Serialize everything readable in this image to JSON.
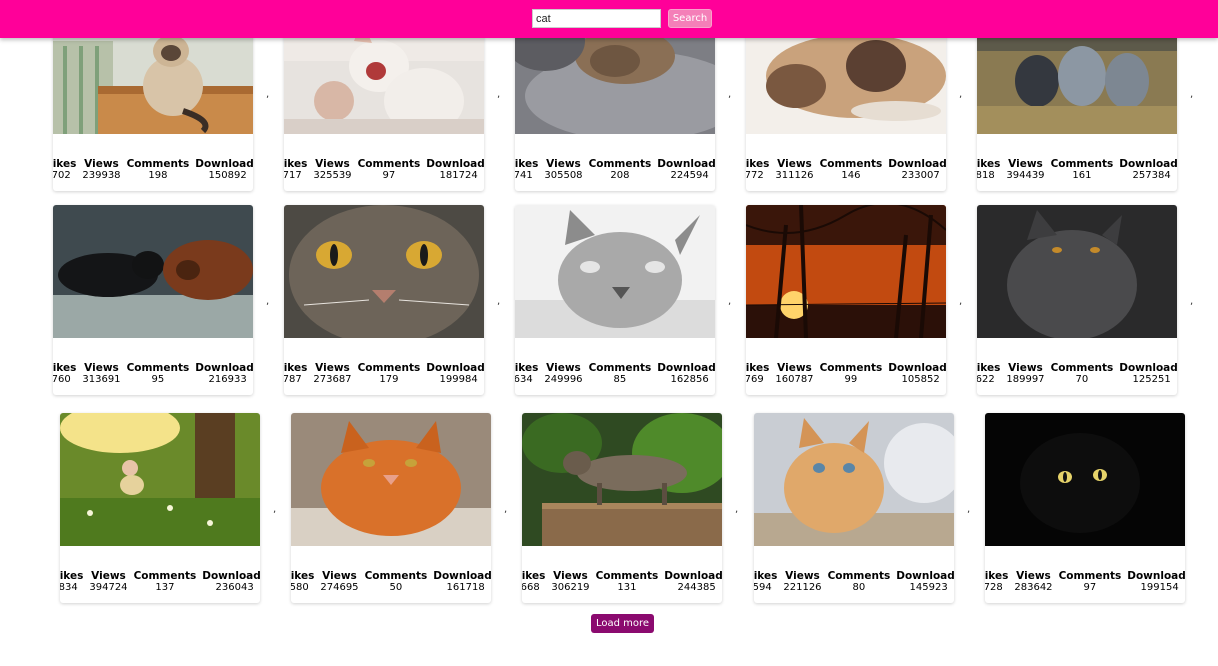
{
  "search": {
    "value": "cat",
    "button_label": "Search"
  },
  "stat_labels": {
    "likes": "Likes",
    "views": "Views",
    "comments": "Comments",
    "downloads": "Downloads"
  },
  "separator": ",",
  "cards": [
    {
      "likes": "702",
      "views": "239938",
      "comments": "198",
      "downloads": "150892"
    },
    {
      "likes": "717",
      "views": "325539",
      "comments": "97",
      "downloads": "181724"
    },
    {
      "likes": "741",
      "views": "305508",
      "comments": "208",
      "downloads": "224594"
    },
    {
      "likes": "772",
      "views": "311126",
      "comments": "146",
      "downloads": "233007"
    },
    {
      "likes": "818",
      "views": "394439",
      "comments": "161",
      "downloads": "257384"
    },
    {
      "likes": "760",
      "views": "313691",
      "comments": "95",
      "downloads": "216933"
    },
    {
      "likes": "787",
      "views": "273687",
      "comments": "179",
      "downloads": "199984"
    },
    {
      "likes": "634",
      "views": "249996",
      "comments": "85",
      "downloads": "162856"
    },
    {
      "likes": "769",
      "views": "160787",
      "comments": "99",
      "downloads": "105852"
    },
    {
      "likes": "622",
      "views": "189997",
      "comments": "70",
      "downloads": "125251"
    },
    {
      "likes": "834",
      "views": "394724",
      "comments": "137",
      "downloads": "236043"
    },
    {
      "likes": "580",
      "views": "274695",
      "comments": "50",
      "downloads": "161718"
    },
    {
      "likes": "668",
      "views": "306219",
      "comments": "131",
      "downloads": "244385"
    },
    {
      "likes": "594",
      "views": "221126",
      "comments": "80",
      "downloads": "145923"
    },
    {
      "likes": "728",
      "views": "283642",
      "comments": "97",
      "downloads": "199154"
    }
  ],
  "load_more_label": "Load more",
  "colors": {
    "header": "#ff0099",
    "search_button": "#f47fb8",
    "load_more": "#8b0a6f"
  }
}
